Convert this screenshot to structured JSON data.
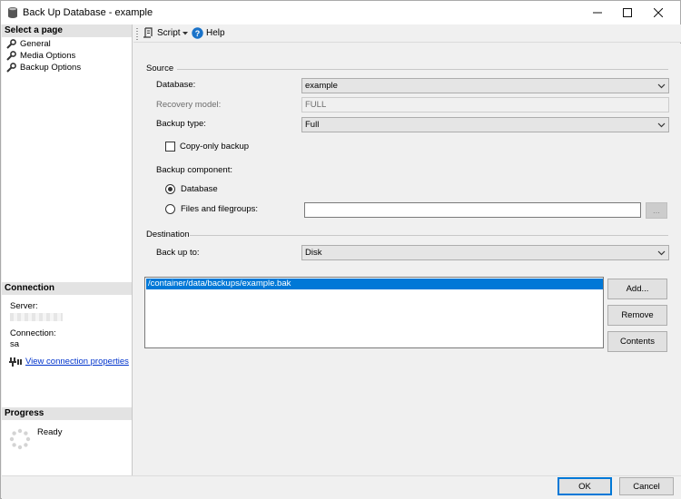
{
  "window": {
    "title": "Back Up Database - example",
    "controls": [
      "minimize",
      "maximize",
      "close"
    ]
  },
  "left_pane": {
    "select_page_header": "Select a page",
    "pages": [
      {
        "label": "General",
        "icon": "wrench-icon"
      },
      {
        "label": "Media Options",
        "icon": "wrench-icon"
      },
      {
        "label": "Backup Options",
        "icon": "wrench-icon"
      }
    ],
    "connection_header": "Connection",
    "server_label": "Server:",
    "connection_label": "Connection:",
    "connection_value": "sa",
    "view_connection_properties": "View connection properties",
    "progress_header": "Progress",
    "progress_status": "Ready"
  },
  "toolbar": {
    "script_label": "Script",
    "help_label": "Help"
  },
  "source": {
    "group_label": "Source",
    "database_label": "Database:",
    "database_value": "example",
    "recovery_model_label": "Recovery model:",
    "recovery_model_value": "FULL",
    "backup_type_label": "Backup type:",
    "backup_type_value": "Full",
    "copy_only_label": "Copy-only backup",
    "copy_only_checked": false,
    "backup_component_label": "Backup component:",
    "component_database_label": "Database",
    "component_files_label": "Files and filegroups:",
    "selected_component": "Database",
    "files_value": "",
    "browse_label": "..."
  },
  "destination": {
    "group_label": "Destination",
    "back_up_to_label": "Back up to:",
    "back_up_to_value": "Disk",
    "paths": [
      "/container/data/backups/example.bak"
    ],
    "add_label": "Add...",
    "remove_label": "Remove",
    "contents_label": "Contents"
  },
  "footer": {
    "ok_label": "OK",
    "cancel_label": "Cancel"
  },
  "colors": {
    "selection": "#0078d7",
    "link": "#0033cc",
    "help_icon": "#1a73c9"
  }
}
